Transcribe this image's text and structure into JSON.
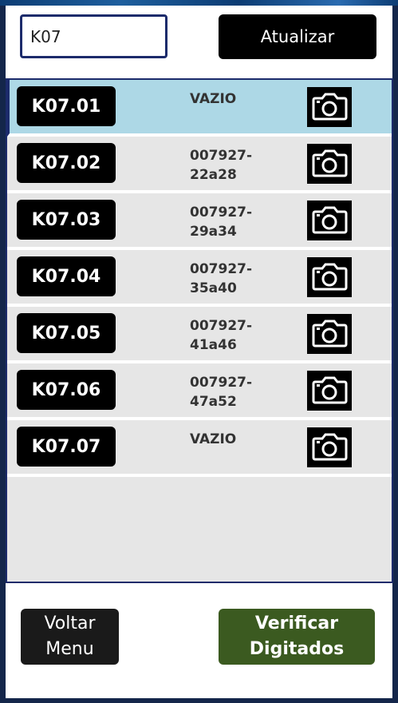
{
  "search": {
    "value": "K07"
  },
  "toolbar": {
    "refresh_label": "Atualizar"
  },
  "rows": [
    {
      "code": "K07.01",
      "status": "VAZIO",
      "selected": true,
      "icon": "camera-icon"
    },
    {
      "code": "K07.02",
      "status": "007927-\n22a28",
      "selected": false,
      "icon": "camera-icon"
    },
    {
      "code": "K07.03",
      "status": "007927-\n29a34",
      "selected": false,
      "icon": "camera-icon"
    },
    {
      "code": "K07.04",
      "status": "007927-\n35a40",
      "selected": false,
      "icon": "camera-icon"
    },
    {
      "code": "K07.05",
      "status": "007927-\n41a46",
      "selected": false,
      "icon": "camera-icon"
    },
    {
      "code": "K07.06",
      "status": "007927-\n47a52",
      "selected": false,
      "icon": "camera-icon"
    },
    {
      "code": "K07.07",
      "status": "VAZIO",
      "selected": false,
      "icon": "camera-icon"
    }
  ],
  "footer": {
    "back_label": "Voltar\nMenu",
    "verify_label": "Verificar\nDigitados"
  },
  "colors": {
    "frame": "#14264a",
    "selected_row": "#add8e6",
    "row": "#e6e6e6",
    "verify_button": "#3b5a20",
    "button_dark": "#000000"
  }
}
